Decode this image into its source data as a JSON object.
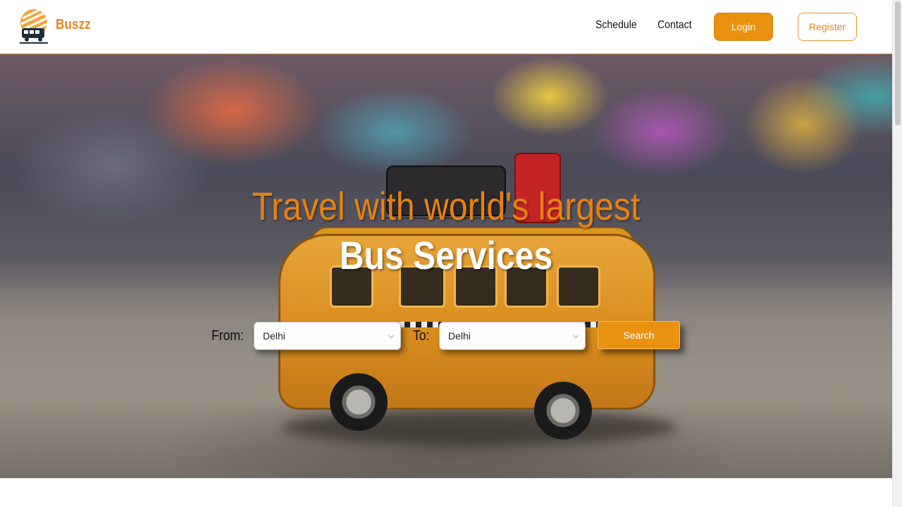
{
  "header": {
    "brand": "Buszz",
    "nav": {
      "schedule": "Schedule",
      "contact": "Contact"
    },
    "login_label": "Login",
    "register_label": "Register"
  },
  "hero": {
    "title": "Travel with world's largest",
    "subtitle": "Bus Services",
    "from_label": "From:",
    "to_label": "To:",
    "from_value": "Delhi",
    "to_value": "Delhi",
    "search_label": "Search"
  },
  "colors": {
    "accent": "#e8920f",
    "brand": "#e8861a",
    "title": "#e8820e"
  }
}
